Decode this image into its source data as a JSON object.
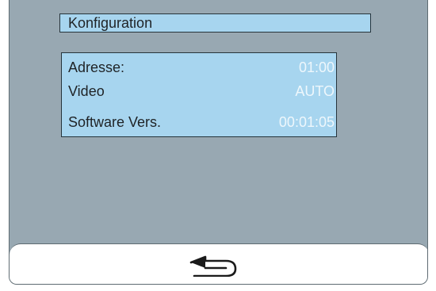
{
  "header": {
    "title": "Konfiguration"
  },
  "info": {
    "rows": [
      {
        "label": "Adresse:",
        "value": "01:00"
      },
      {
        "label": "Video",
        "value": "AUTO"
      },
      {
        "label": "Software Vers.",
        "value": "00:01:05"
      }
    ]
  },
  "footer": {
    "back_icon": "back-arrow-icon"
  },
  "colors": {
    "screen_background": "#98a8b2",
    "panel_background": "#a7d5ef",
    "label_text": "#1f2326",
    "value_text": "#eef7fc"
  }
}
